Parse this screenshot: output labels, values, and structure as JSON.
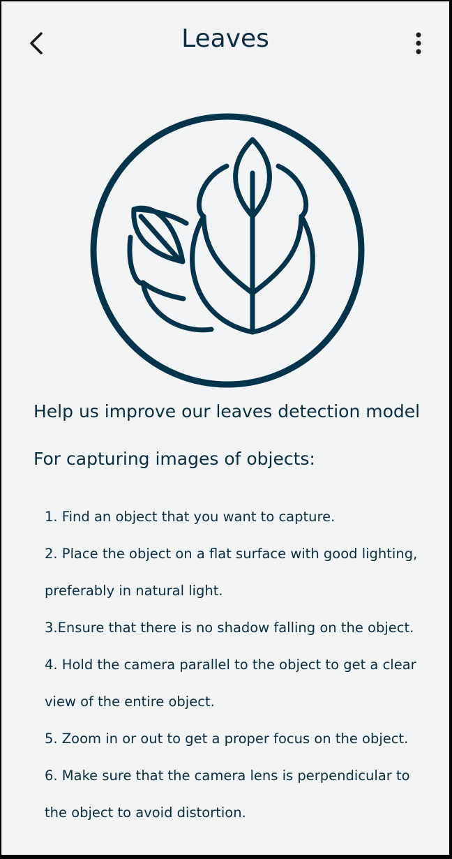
{
  "header": {
    "title": "Leaves",
    "back_icon": "chevron-left-icon",
    "menu_icon": "more-vertical-icon"
  },
  "illustration": {
    "icon": "leaves-icon",
    "stroke_color": "#04344c"
  },
  "content": {
    "headline": "Help us improve our leaves detection model",
    "subhead": "For capturing images of objects:",
    "instruction_lines": [
      "  1. Find an object that you want to capture.",
      "  2. Place the object on a flat surface with good lighting,",
      "preferably in natural light.",
      "  3.Ensure that there is no shadow falling on the object.",
      "  4. Hold the camera parallel to the object to get a clear",
      "view of the entire object.",
      "  5. Zoom in or out to get a proper focus on the object.",
      "  6. Make sure that the camera lens is perpendicular to",
      "the object to avoid distortion."
    ]
  },
  "colors": {
    "background": "#f2f4f6",
    "text": "#0b2d42",
    "frame": "#000000"
  }
}
